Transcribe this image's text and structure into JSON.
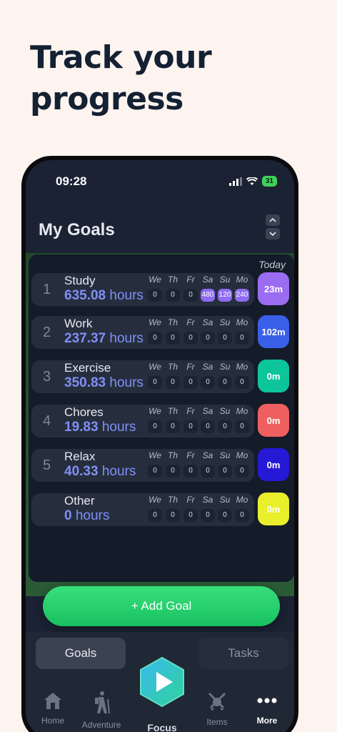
{
  "headline": "Track your\nprogress",
  "status_bar": {
    "time": "09:28",
    "battery": "31"
  },
  "page_title": "My Goals",
  "today_label": "Today",
  "day_headers": [
    "We",
    "Th",
    "Fr",
    "Sa",
    "Su",
    "Mo"
  ],
  "goals": [
    {
      "num": "1",
      "name": "Study",
      "hours": "635.08",
      "unit": "hours",
      "days": [
        "0",
        "0",
        "0",
        "480",
        "120",
        "240"
      ],
      "active": [
        false,
        false,
        false,
        true,
        true,
        true
      ],
      "today": "23m",
      "color": "#9b6cf2"
    },
    {
      "num": "2",
      "name": "Work",
      "hours": "237.37",
      "unit": "hours",
      "days": [
        "0",
        "0",
        "0",
        "0",
        "0",
        "0"
      ],
      "active": [
        false,
        false,
        false,
        false,
        false,
        false
      ],
      "today": "102m",
      "color": "#3a5fe8"
    },
    {
      "num": "3",
      "name": "Exercise",
      "hours": "350.83",
      "unit": "hours",
      "days": [
        "0",
        "0",
        "0",
        "0",
        "0",
        "0"
      ],
      "active": [
        false,
        false,
        false,
        false,
        false,
        false
      ],
      "today": "0m",
      "color": "#0cc59a"
    },
    {
      "num": "4",
      "name": "Chores",
      "hours": "19.83",
      "unit": "hours",
      "days": [
        "0",
        "0",
        "0",
        "0",
        "0",
        "0"
      ],
      "active": [
        false,
        false,
        false,
        false,
        false,
        false
      ],
      "today": "0m",
      "color": "#ef5f5f"
    },
    {
      "num": "5",
      "name": "Relax",
      "hours": "40.33",
      "unit": "hours",
      "days": [
        "0",
        "0",
        "0",
        "0",
        "0",
        "0"
      ],
      "active": [
        false,
        false,
        false,
        false,
        false,
        false
      ],
      "today": "0m",
      "color": "#2619d6"
    },
    {
      "num": "",
      "name": "Other",
      "hours": "0",
      "unit": "hours",
      "days": [
        "0",
        "0",
        "0",
        "0",
        "0",
        "0"
      ],
      "active": [
        false,
        false,
        false,
        false,
        false,
        false
      ],
      "today": "0m",
      "color": "#e9ef2a"
    }
  ],
  "add_goal_label": "+ Add Goal",
  "tabs": {
    "goals": "Goals",
    "tasks": "Tasks"
  },
  "nav": {
    "home": "Home",
    "adventure": "Adventure",
    "focus": "Focus",
    "items": "Items",
    "more": "More"
  }
}
